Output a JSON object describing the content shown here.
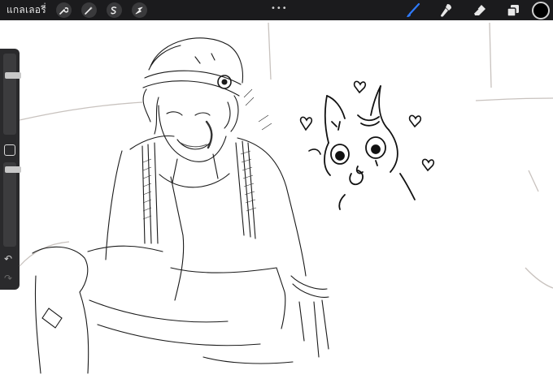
{
  "topbar": {
    "gallery_label": "แกลเลอรี่",
    "left_tools": [
      {
        "name": "wrench-icon",
        "label": "Actions"
      },
      {
        "name": "magic-wand-icon",
        "label": "Adjustments"
      },
      {
        "name": "selection-icon",
        "label": "Selection"
      },
      {
        "name": "transform-arrow-icon",
        "label": "Transform"
      }
    ],
    "grabber": "•••",
    "right_tools": [
      {
        "name": "brush-icon",
        "active": true
      },
      {
        "name": "smudge-icon",
        "active": false
      },
      {
        "name": "eraser-icon",
        "active": false
      },
      {
        "name": "layers-icon",
        "active": false
      }
    ],
    "active_color": "#000000",
    "accent_color": "#2f7bff"
  },
  "sidebar": {
    "brush_size_level": 0.75,
    "opacity_level": 0.95,
    "undo_glyph": "↶",
    "redo_glyph": "↷"
  }
}
